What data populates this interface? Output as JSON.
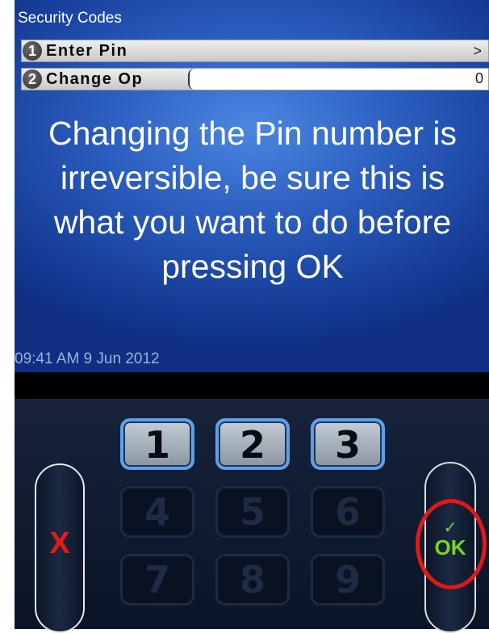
{
  "screen": {
    "title": "Security Codes",
    "menu": [
      {
        "number": "1",
        "label": "Enter Pin",
        "chevron": ">"
      },
      {
        "number": "2",
        "label": "Change Op",
        "input_value": "0"
      }
    ],
    "warning": "Changing the Pin number is irreversible, be sure this is what you want to do before pressing OK",
    "timestamp": "09:41 AM 9 Jun 2012"
  },
  "keypad": {
    "cancel_label": "X",
    "ok_check": "✓",
    "ok_label": "OK",
    "keys": [
      "1",
      "2",
      "3",
      "4",
      "5",
      "6",
      "7",
      "8",
      "9"
    ],
    "active_keys": [
      "1",
      "2",
      "3"
    ]
  },
  "colors": {
    "screen_blue": "#2c5fc0",
    "cancel_red": "#e81a10",
    "ok_green": "#7ed321",
    "highlight_circle": "#e01818",
    "key_border_active": "#5ea0e8"
  }
}
